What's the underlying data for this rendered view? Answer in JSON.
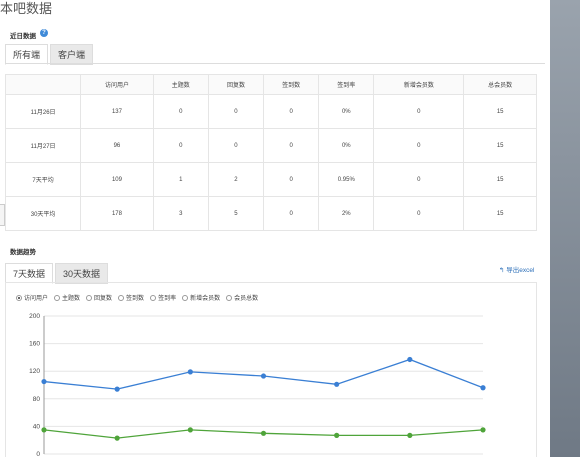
{
  "page": {
    "title": "本吧数据"
  },
  "recent": {
    "title": "近日数据",
    "help_icon": "?",
    "tabs": [
      "所有端",
      "客户端"
    ],
    "table": {
      "headers": [
        "",
        "访问用户",
        "主题数",
        "回复数",
        "签到数",
        "签到率",
        "新增会员数",
        "总会员数"
      ],
      "rows": [
        [
          "11月26日",
          "137",
          "0",
          "0",
          "0",
          "0%",
          "0",
          "15"
        ],
        [
          "11月27日",
          "96",
          "0",
          "0",
          "0",
          "0%",
          "0",
          "15"
        ],
        [
          "7天平均",
          "109",
          "1",
          "2",
          "0",
          "0.95%",
          "0",
          "15"
        ],
        [
          "30天平均",
          "178",
          "3",
          "5",
          "0",
          "2%",
          "0",
          "15"
        ]
      ]
    }
  },
  "trend": {
    "title": "数据趋势",
    "tabs": [
      "7天数据",
      "30天数据"
    ],
    "export_label": "导出excel",
    "legend": [
      {
        "label": "访问用户",
        "checked": true
      },
      {
        "label": "主题数",
        "checked": false
      },
      {
        "label": "回复数",
        "checked": false
      },
      {
        "label": "签到数",
        "checked": false
      },
      {
        "label": "签到率",
        "checked": false
      },
      {
        "label": "新增会员数",
        "checked": false
      },
      {
        "label": "会员总数",
        "checked": false
      }
    ]
  },
  "chart_data": {
    "type": "line",
    "ylim": [
      0,
      200
    ],
    "yticks": [
      0,
      40,
      80,
      120,
      160,
      200
    ],
    "series": [
      {
        "color": "#3a7fd4",
        "values": [
          105,
          94,
          119,
          113,
          101,
          137,
          96
        ]
      },
      {
        "color": "#4fa43a",
        "values": [
          35,
          23,
          35,
          30,
          27,
          27,
          35
        ]
      }
    ]
  },
  "colors": {
    "accent": "#2c6fb9",
    "help": "#3f8ad8"
  }
}
